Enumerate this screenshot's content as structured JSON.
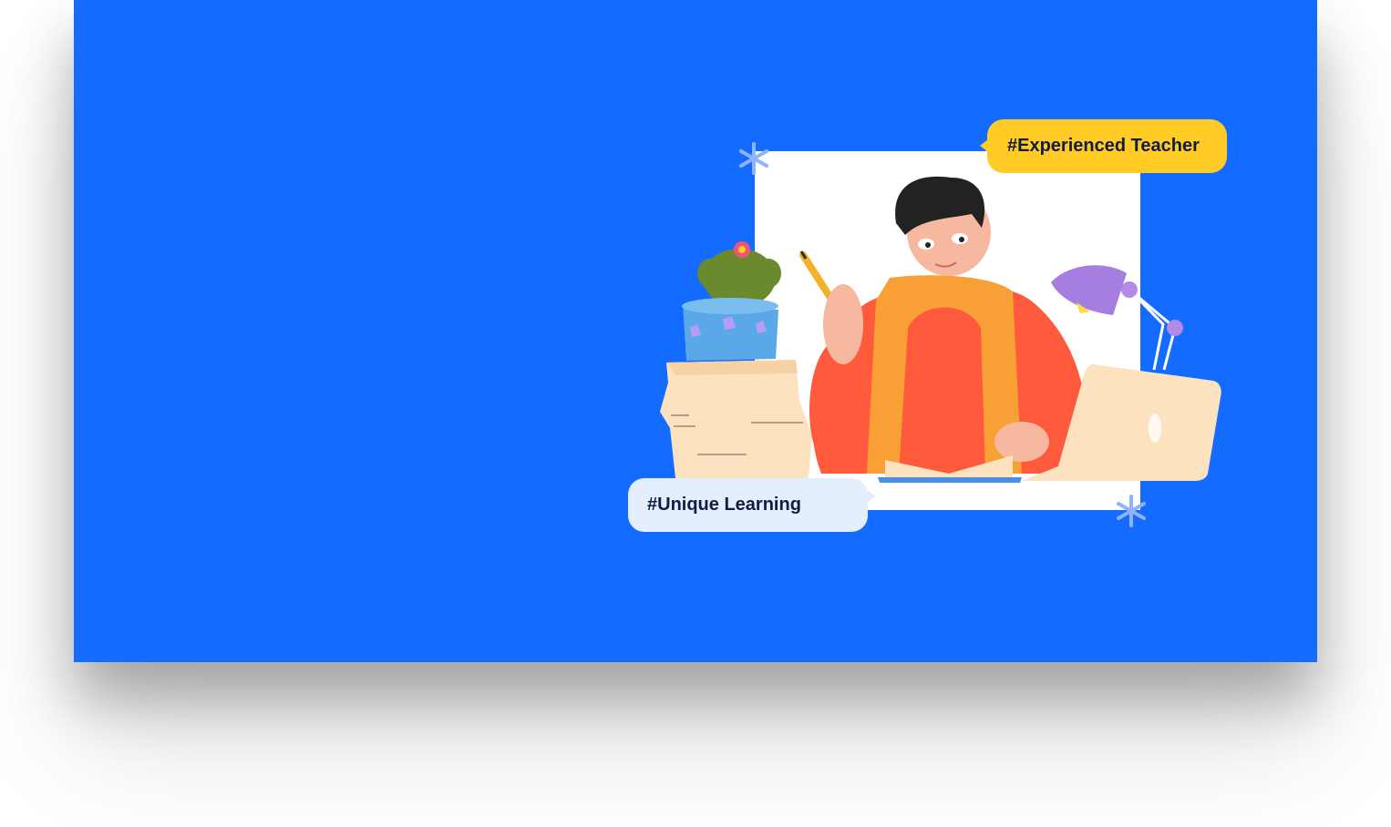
{
  "hero": {
    "background_color": "#136bff",
    "tags": {
      "experienced": "#Experienced Teacher",
      "unique": "#Unique Learning"
    },
    "tag_colors": {
      "experienced_bg": "#ffcb24",
      "unique_bg": "#e4eeff",
      "text": "#121c3d"
    },
    "illustration": {
      "subject": "person-studying-at-desk",
      "icons": [
        "sparkle-icon",
        "cactus-icon",
        "desk-lamp-icon",
        "laptop-icon",
        "pencil-icon",
        "book-icon",
        "paper-stack-icon"
      ]
    }
  }
}
